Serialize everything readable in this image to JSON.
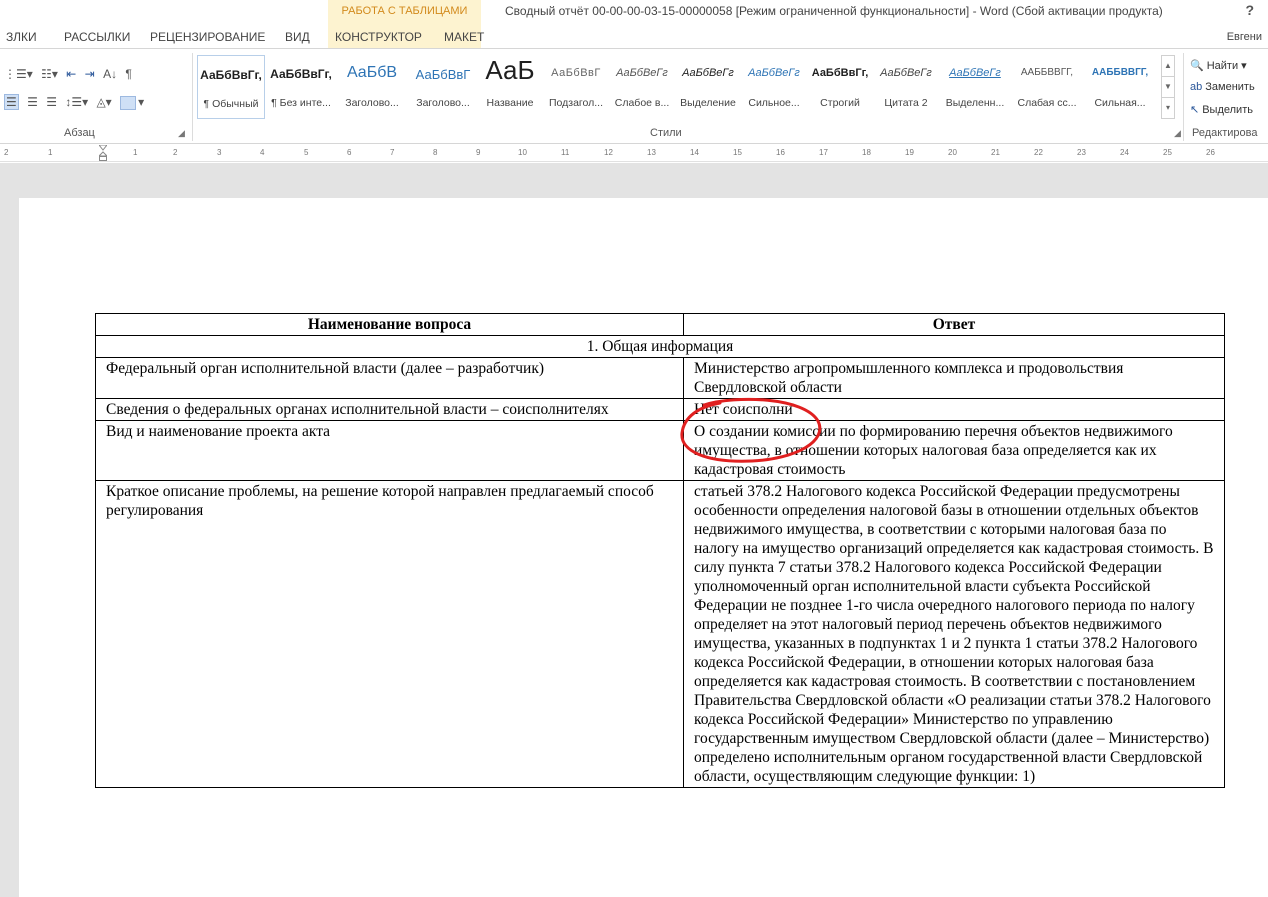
{
  "window": {
    "context_tab": "РАБОТА С ТАБЛИЦАМИ",
    "title": "Сводный отчёт 00-00-00-03-15-00000058 [Режим ограниченной функциональности] - Word (Сбой активации продукта)",
    "help": "?"
  },
  "tabs": [
    {
      "label": "ЗЛКИ"
    },
    {
      "label": "РАССЫЛКИ"
    },
    {
      "label": "РЕЦЕНЗИРОВАНИЕ"
    },
    {
      "label": "ВИД"
    },
    {
      "label": "КОНСТРУКТОР"
    },
    {
      "label": "МАКЕТ"
    }
  ],
  "user": {
    "name": "Евгени"
  },
  "ribbon": {
    "paragraph_group": "Абзац",
    "styles_group": "Стили",
    "editing_group": "Редактирова",
    "styles": [
      {
        "sample": "АаБбВвГг,",
        "name": "¶ Обычный"
      },
      {
        "sample": "АаБбВвГг,",
        "name": "¶ Без инте..."
      },
      {
        "sample": "АаБбВ",
        "name": "Заголово..."
      },
      {
        "sample": "АаБбВвГ",
        "name": "Заголово..."
      },
      {
        "sample": "АаБ",
        "name": "Название"
      },
      {
        "sample": "АаБбВвГ",
        "name": "Подзагол..."
      },
      {
        "sample": "АаБбВеГг",
        "name": "Слабое в..."
      },
      {
        "sample": "АаБбВеГг",
        "name": "Выделение"
      },
      {
        "sample": "АаБбВеГг",
        "name": "Сильное..."
      },
      {
        "sample": "АаБбВвГг,",
        "name": "Строгий"
      },
      {
        "sample": "АаБбВеГг",
        "name": "Цитата 2"
      },
      {
        "sample": "АаБбВеГг",
        "name": "Выделенн..."
      },
      {
        "sample": "ААББВВГГ,",
        "name": "Слабая сс..."
      },
      {
        "sample": "ААББВВГГ,",
        "name": "Сильная..."
      }
    ],
    "editing": {
      "find": "Найти",
      "replace": "Заменить",
      "select": "Выделить"
    }
  },
  "ruler": {
    "labels": [
      "2",
      "1",
      "1",
      "2",
      "3",
      "4",
      "5",
      "6",
      "7",
      "8",
      "9",
      "10",
      "11",
      "12",
      "13",
      "14",
      "15",
      "16",
      "17",
      "18",
      "19",
      "20",
      "21",
      "22",
      "23",
      "24",
      "25",
      "26"
    ]
  },
  "table": {
    "headers": [
      "Наименование вопроса",
      "Ответ"
    ],
    "section_title": "1.   Общая информация",
    "rows": [
      {
        "question": "Федеральный орган исполнительной власти (далее – разработчик)",
        "answer": "Министерство агропромышленного комплекса и продовольствия Свердловской области"
      },
      {
        "question": "Сведения о федеральных органах исполнительной власти – соисполнителях",
        "answer": "Нет соисполни"
      },
      {
        "question": "Вид и наименование проекта акта",
        "answer": "О создании комиссии по формированию перечня объектов недвижимого имущества, в отношении которых налоговая база определяется как их кадастровая стоимость"
      },
      {
        "question": "Краткое описание проблемы, на решение которой направлен предлагаемый способ регулирования",
        "answer": "статьей 378.2 Налогового кодекса Российской Федерации предусмотрены особенности определения налоговой базы в отношении отдельных объектов недвижимого имущества, в соответствии с которыми налоговая база по налогу на имущество организаций определяется как кадастровая стоимость. В силу пункта 7 статьи 378.2 Налогового кодекса Российской Федерации уполномоченный орган исполнительной власти субъекта Российской Федерации не позднее 1-го числа очередного налогового периода по налогу определяет на этот налоговый период перечень объектов недвижимого имущества, указанных в подпунктах 1 и 2 пункта 1 статьи 378.2 Налогового кодекса Российской Федерации, в отношении которых налоговая база определяется как кадастровая стоимость. В соответствии с постановлением Правительства Свердловской области «О реализации статьи 378.2 Налогового кодекса Российской Федерации» Министерство по управлению государственным имуществом Свердловской области (далее – Министерство) определено исполнительным органом государственной власти Свердловской области, осуществляющим следующие функции: 1)"
      }
    ]
  },
  "colors": {
    "context_tab_bg": "#fdf3d0",
    "context_tab_text": "#d28a1c",
    "annotation": "#e02020",
    "canvas": "#e3e3e3"
  }
}
